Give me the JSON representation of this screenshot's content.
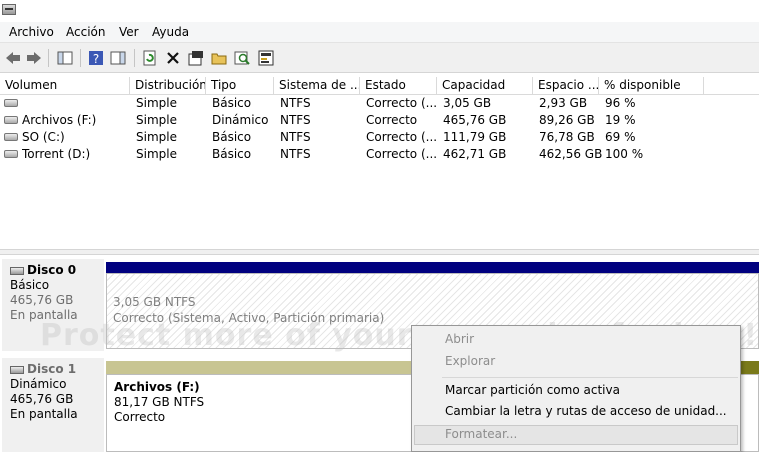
{
  "menubar": {
    "items": [
      "Archivo",
      "Acción",
      "Ver",
      "Ayuda"
    ]
  },
  "toolbar": {
    "icons": [
      "back-icon",
      "forward-icon",
      "console-tree-icon",
      "help-icon",
      "properties-list-icon",
      "refresh-icon",
      "delete-icon",
      "properties-icon",
      "open-icon",
      "explore-icon",
      "settings-icon"
    ]
  },
  "table": {
    "columns": [
      "Volumen",
      "Distribución",
      "Tipo",
      "Sistema de ...",
      "Estado",
      "Capacidad",
      "Espacio ...",
      "% disponible"
    ],
    "rows": [
      {
        "volumen": "",
        "distribucion": "Simple",
        "tipo": "Básico",
        "sistema": "NTFS",
        "estado": "Correcto (...",
        "capacidad": "3,05 GB",
        "espacio": "2,93 GB",
        "disponible": "96 %"
      },
      {
        "volumen": "Archivos (F:)",
        "distribucion": "Simple",
        "tipo": "Dinámico",
        "sistema": "NTFS",
        "estado": "Correcto",
        "capacidad": "465,76 GB",
        "espacio": "89,26 GB",
        "disponible": "19 %"
      },
      {
        "volumen": "SO (C:)",
        "distribucion": "Simple",
        "tipo": "Básico",
        "sistema": "NTFS",
        "estado": "Correcto (...",
        "capacidad": "111,79 GB",
        "espacio": "76,78 GB",
        "disponible": "69 %"
      },
      {
        "volumen": "Torrent (D:)",
        "distribucion": "Simple",
        "tipo": "Básico",
        "sistema": "NTFS",
        "estado": "Correcto (...",
        "capacidad": "462,71 GB",
        "espacio": "462,56 GB",
        "disponible": "100 %"
      }
    ]
  },
  "disks": [
    {
      "name": "Disco 0",
      "type": "Básico",
      "size": "465,76 GB",
      "status": "En pantalla"
    },
    {
      "name": "Disco 1",
      "type": "Dinámico",
      "size": "465,76 GB",
      "status": "En pantalla"
    }
  ],
  "partitions": {
    "disk0": {
      "line1": "3,05 GB NTFS",
      "line2": "Correcto (Sistema, Activo, Partición primaria)"
    },
    "disk1": {
      "name": "Archivos  (F:)",
      "line1": "81,17 GB NTFS",
      "line2": "Correcto"
    }
  },
  "watermark": "Protect more of your memories for less!",
  "context_menu": {
    "items": [
      "Abrir",
      "Explorar",
      "Marcar partición como activa",
      "Cambiar la letra y rutas de acceso de unidad...",
      "Formatear..."
    ]
  },
  "colors": {
    "disk0_bar": "#00007f",
    "disk1_bar": "#c8c592"
  }
}
